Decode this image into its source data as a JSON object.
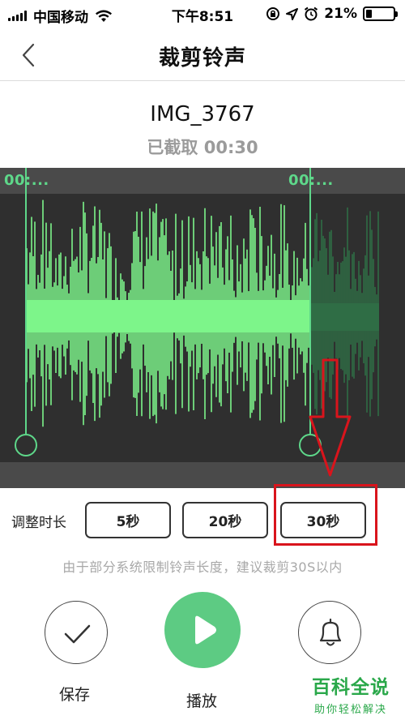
{
  "status_bar": {
    "carrier": "中国移动",
    "time": "下午8:51",
    "battery_percent": "21%",
    "battery_level": 0.21,
    "icons": [
      "signal-icon",
      "wifi-icon",
      "rotation-lock-icon",
      "location-icon",
      "alarm-icon",
      "battery-icon"
    ]
  },
  "nav": {
    "title": "裁剪铃声",
    "back_icon": "chevron-left-icon"
  },
  "file": {
    "name": "IMG_3767",
    "captured_label": "已截取 00:30"
  },
  "waveform": {
    "start_label": "00:...",
    "end_label": "00:...",
    "colors": {
      "selected": "#7df58a",
      "unselected": "#2f6d45",
      "handle": "#5ed88a",
      "background": "#2f2f2f"
    }
  },
  "duration": {
    "label": "调整时长",
    "options": [
      {
        "label": "5秒"
      },
      {
        "label": "20秒"
      },
      {
        "label": "30秒"
      }
    ],
    "highlight_color": "#d9141c"
  },
  "hint": "由于部分系统限制铃声长度，建议裁剪30S以内",
  "controls": {
    "save_label": "保存",
    "play_label": "播放",
    "play_color": "#5dcb83"
  },
  "watermark": {
    "main": "百科全说",
    "sub": "助你轻松解决"
  }
}
